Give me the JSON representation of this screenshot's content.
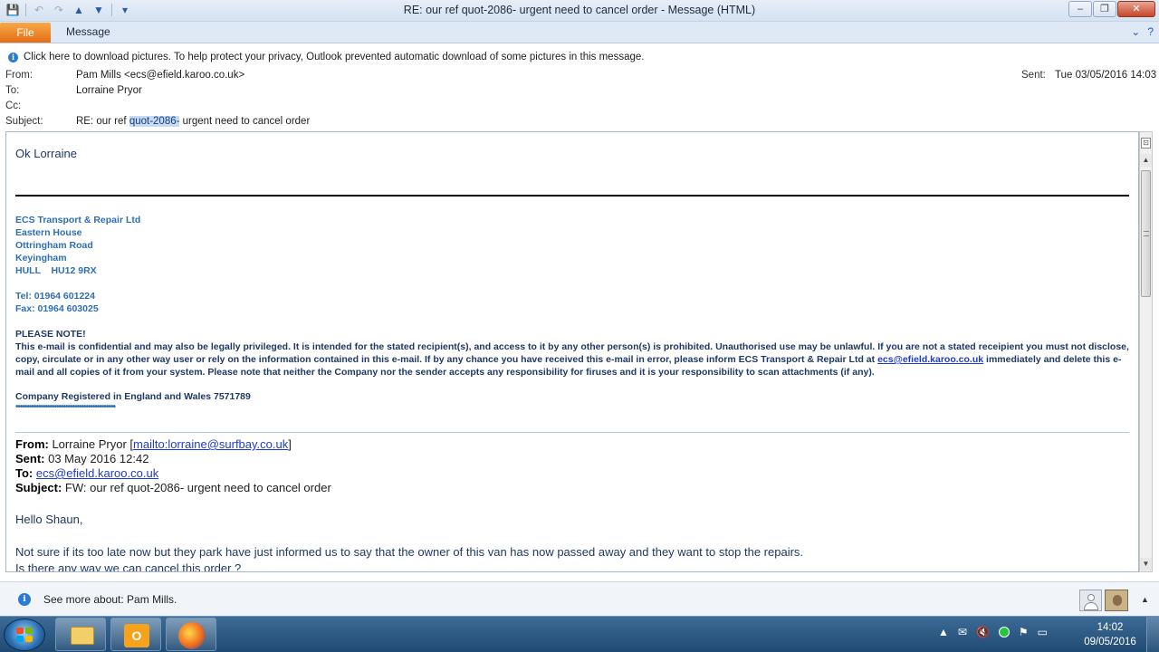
{
  "window": {
    "title": "RE: our ref quot-2086- urgent need to cancel order  -  Message (HTML)",
    "minimize": "–",
    "maximize": "❐",
    "close": "✕"
  },
  "ribbon": {
    "file_tab": "File",
    "message_tab": "Message"
  },
  "infobar": {
    "text": "Click here to download pictures. To help protect your privacy, Outlook prevented automatic download of some pictures in this message."
  },
  "header": {
    "from_label": "From:",
    "from_value": "Pam Mills <ecs@efield.karoo.co.uk>",
    "to_label": "To:",
    "to_value": "Lorraine Pryor",
    "cc_label": "Cc:",
    "cc_value": "",
    "subject_label": "Subject:",
    "subject_prefix": "RE: our ref ",
    "subject_highlight": "quot-2086-",
    "subject_suffix": " urgent need to cancel order",
    "sent_label": "Sent:",
    "sent_value": "Tue 03/05/2016 14:03"
  },
  "body": {
    "greeting": "Ok Lorraine",
    "signature": [
      "ECS Transport & Repair Ltd",
      "Eastern House",
      "Ottringham Road",
      "Keyingham",
      "HULL    HU12 9RX",
      "",
      "Tel: 01964 601224",
      "Fax: 01964 603025"
    ],
    "notice_title": "PLEASE NOTE!",
    "notice_text_1": "This e-mail is confidential and may also be legally privileged.  It is intended for the stated recipient(s), and access to it by any other person(s) is prohibited.  Unauthorised use may be unlawful.  If you are not a stated receipient you must not disclose, copy, circulate or in any other way user or rely on the information contained in this e-mail.  If by any chance you have received this e-mail in error, please inform ECS Transport & Repair Ltd at ",
    "notice_link": "ecs@efield.karoo.co.uk",
    "notice_text_2": " immediately and delete this e-mail and all copies of it from your system.  Please note that neither the Company nor the sender accepts any responsibility for firuses and it is your responsibility to scan attachments (if any).",
    "registered": "Company Registered in England and Wales 7571789",
    "dots": "••••••••••••••••••••••••••••••••••••••••••••",
    "fwd_from_label": "From:",
    "fwd_from_value": " Lorraine Pryor [",
    "fwd_from_link": "mailto:lorraine@surfbay.co.uk",
    "fwd_from_close": "]",
    "fwd_sent_label": "Sent:",
    "fwd_sent_value": " 03 May 2016 12:42",
    "fwd_to_label": "To:",
    "fwd_to_link": "ecs@efield.karoo.co.uk",
    "fwd_subject_label": "Subject:",
    "fwd_subject_value": " FW: our ref quot-2086- urgent need to cancel order",
    "hello": "Hello Shaun,",
    "para1": "Not sure if its too late now but they park have just informed us to say that the owner of this van has now passed away and they want to stop the repairs.",
    "para2": "Is there any way we can cancel this order ?"
  },
  "people_pane": {
    "text": "See more about: Pam Mills."
  },
  "taskbar": {
    "time": "14:02",
    "date": "09/05/2016"
  }
}
